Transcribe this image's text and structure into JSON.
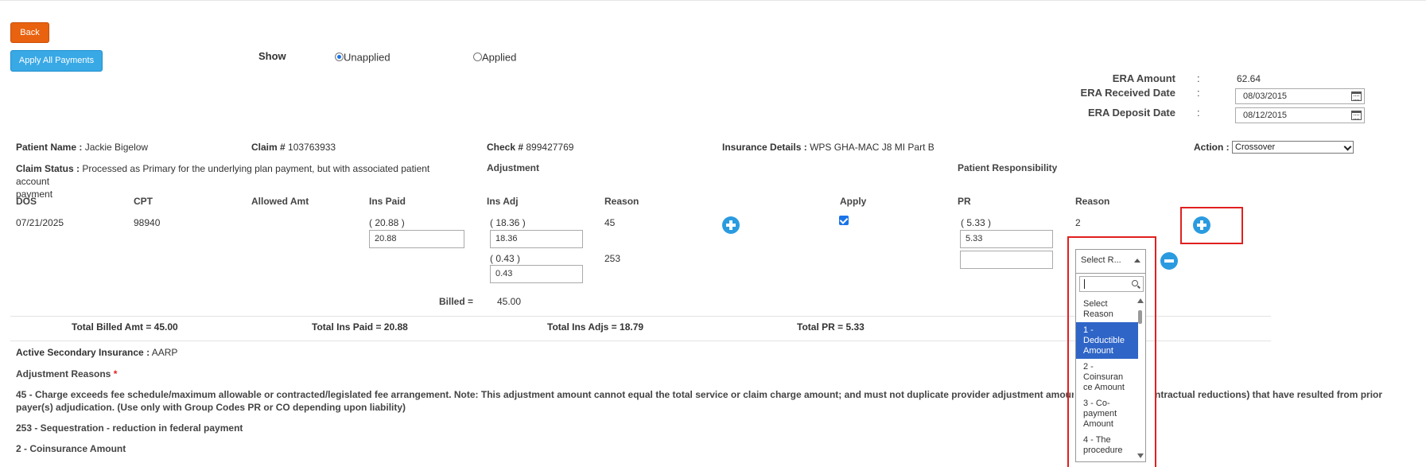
{
  "toolbar": {
    "back_label": "Back",
    "apply_all_label": "Apply All Payments"
  },
  "show": {
    "label": "Show",
    "options": [
      "Unapplied",
      "Applied"
    ],
    "selected": "Unapplied"
  },
  "era": {
    "amount_label": "ERA Amount",
    "amount_value": "62.64",
    "received_label": "ERA Received Date",
    "received_value": "08/03/2015",
    "deposit_label": "ERA Deposit Date",
    "deposit_value": "08/12/2015",
    "colon": ":"
  },
  "claim": {
    "patient_label": "Patient Name :",
    "patient_value": "Jackie Bigelow",
    "claim_label": "Claim #",
    "claim_value": "103763933",
    "check_label": "Check #",
    "check_value": "899427769",
    "insurance_label": "Insurance Details :",
    "insurance_value": "WPS GHA-MAC J8 MI Part B",
    "action_label": "Action :",
    "action_value": "Crossover",
    "status_label": "Claim Status :",
    "status_value_1": "Processed as Primary for the underlying plan payment, but with associated patient account",
    "status_value_2": "payment"
  },
  "sections": {
    "adjustment": "Adjustment",
    "patient_responsibility": "Patient Responsibility"
  },
  "columns": {
    "dos": "DOS",
    "cpt": "CPT",
    "allowed": "Allowed Amt",
    "ins_paid": "Ins Paid",
    "ins_adj": "Ins Adj",
    "reason": "Reason",
    "apply": "Apply",
    "pr": "PR",
    "pr_reason": "Reason"
  },
  "line": {
    "dos": "07/21/2025",
    "cpt": "98940",
    "ins_paid_display": "( 20.88 )",
    "ins_paid_input": "20.88",
    "adj_1_display": "( 18.36 )",
    "adj_1_input": "18.36",
    "adj_1_reason": "45",
    "adj_2_display": "( 0.43 )",
    "adj_2_input": "0.43",
    "adj_2_reason": "253",
    "apply_checked": true,
    "pr_display": "( 5.33 )",
    "pr_input": "5.33",
    "pr_reason": "2",
    "pr_input_2": ""
  },
  "billed": {
    "label": "Billed =",
    "value": "45.00"
  },
  "totals": {
    "billed": "Total Billed Amt = 45.00",
    "ins_paid": "Total Ins Paid = 20.88",
    "ins_adjs": "Total Ins Adjs = 18.79",
    "pr": "Total PR = 5.33"
  },
  "secondary": {
    "label": "Active Secondary Insurance :",
    "value": "AARP"
  },
  "adjustment_reasons": {
    "title": "Adjustment Reasons",
    "required_mark": "*",
    "line_45_a": "45 - Charge exceeds fee schedule/maximum allowable or contracted/legislated fee arrangement. Note: This adjustment amount cannot equal the total service or claim charge amount; and must not duplicate provider adjustment amounts (p",
    "line_45_b": "ntractual reductions) that have resulted from prior",
    "line_45_c": "payer(s) adjudication. (Use only with Group Codes PR or CO depending upon liability)",
    "line_253": "253 - Sequestration - reduction in federal payment",
    "line_2": "2 - Coinsurance Amount"
  },
  "reason_dropdown": {
    "selected_label": "Select R...",
    "search_value": "",
    "options": [
      "Select Reason",
      "1 - Deductible Amount",
      "2 - Coinsurance Amount",
      "3 - Co-payment Amount",
      "4 - The procedure"
    ],
    "option_lines": [
      [
        "Select",
        "Reason"
      ],
      [
        "1 -",
        "Deductible",
        "Amount"
      ],
      [
        "2 -",
        "Coinsuran",
        "ce Amount"
      ],
      [
        "3 - Co-",
        "payment",
        "Amount"
      ],
      [
        "4 - The",
        "procedure"
      ]
    ],
    "highlighted_index": 1
  },
  "colors": {
    "back_button": "#e8620f",
    "apply_button": "#39a9e6",
    "plus_button": "#2b9be0",
    "highlight_border": "#e02020",
    "selected_option": "#2f65c7"
  },
  "icons": [
    "calendar-icon",
    "plus-circle-icon",
    "minus-circle-icon",
    "search-icon",
    "chevron-down-icon",
    "checkbox-checked-icon"
  ]
}
